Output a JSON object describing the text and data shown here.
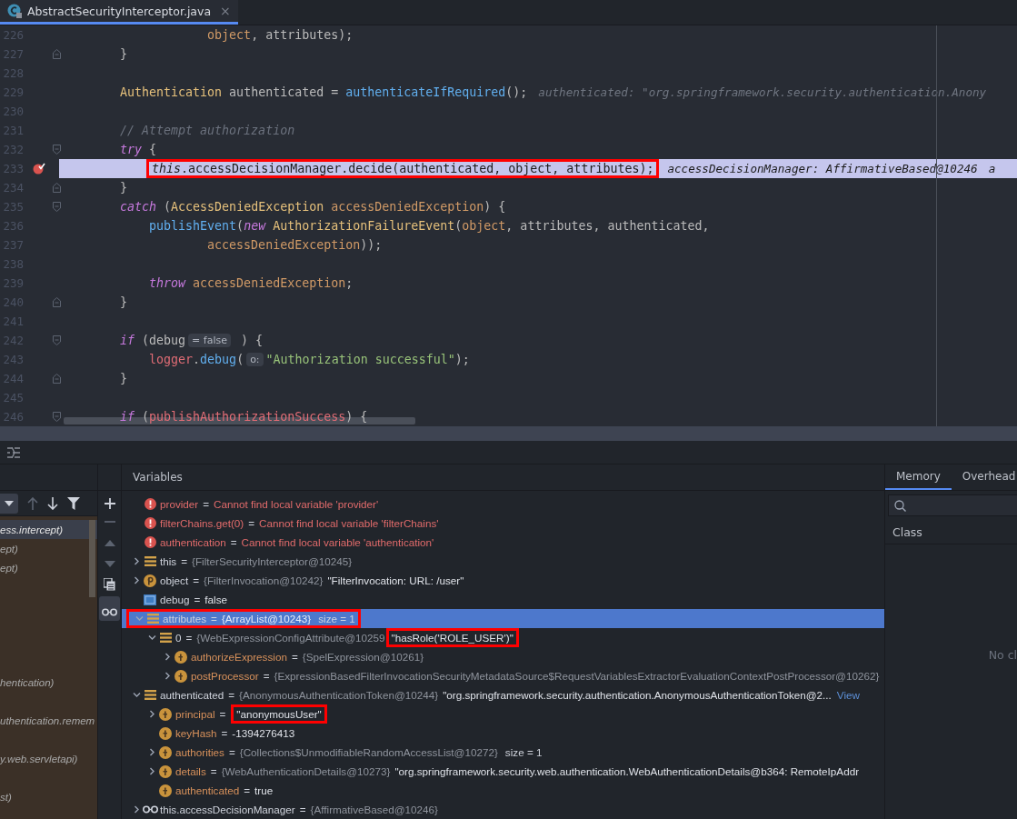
{
  "editor_tab": {
    "title": "AbstractSecurityInterceptor.java",
    "close": "×",
    "selected": true
  },
  "code_lines": [
    {
      "number": "226",
      "current": false,
      "breakpoint": false,
      "fold_start": false,
      "fold_end": false,
      "tokens": [
        {
          "kind": "local",
          "text": "                object"
        },
        {
          "kind": "plain",
          "text": ", attributes);"
        }
      ]
    },
    {
      "number": "227",
      "current": false,
      "breakpoint": false,
      "fold_start": false,
      "fold_end": true,
      "tokens": [
        {
          "kind": "plain",
          "text": "    }"
        }
      ]
    },
    {
      "number": "228",
      "current": false,
      "breakpoint": false,
      "fold_start": false,
      "fold_end": false
    },
    {
      "number": "229",
      "current": false,
      "breakpoint": false,
      "fold_start": false,
      "fold_end": false,
      "tokens": [
        {
          "kind": "type",
          "text": "    Authentication"
        },
        {
          "kind": "plain",
          "text": " authenticated = "
        },
        {
          "kind": "method",
          "text": "authenticateIfRequired"
        },
        {
          "kind": "plain",
          "text": "();"
        },
        {
          "kind": "hint",
          "text": "authenticated: \"org.springframework.security.authentication.Anony"
        }
      ]
    },
    {
      "number": "230",
      "current": false,
      "breakpoint": false,
      "fold_start": false,
      "fold_end": false
    },
    {
      "number": "231",
      "current": false,
      "breakpoint": false,
      "fold_start": false,
      "fold_end": false,
      "tokens": [
        {
          "kind": "comment",
          "text": "    // Attempt authorization"
        }
      ]
    },
    {
      "number": "232",
      "current": false,
      "breakpoint": false,
      "fold_start": true,
      "fold_end": false,
      "tokens": [
        {
          "kind": "keyword",
          "text": "    try"
        },
        {
          "kind": "plain",
          "text": " {"
        }
      ]
    },
    {
      "number": "233",
      "current": true,
      "breakpoint": true,
      "fold_start": false,
      "fold_end": false,
      "boxed": true,
      "tokens": [
        {
          "kind": "keyword",
          "text": "        this"
        },
        {
          "kind": "plain",
          "text": ".accessDecisionManager.decide(authenticated, object, attributes);"
        },
        {
          "kind": "hint",
          "text": "accessDecisionManager: AffirmativeBased@10246"
        },
        {
          "kind": "hint",
          "text": "a"
        }
      ]
    },
    {
      "number": "234",
      "current": false,
      "breakpoint": false,
      "fold_start": false,
      "fold_end": true,
      "tokens": [
        {
          "kind": "plain",
          "text": "    }"
        }
      ]
    },
    {
      "number": "235",
      "current": false,
      "breakpoint": false,
      "fold_start": true,
      "fold_end": false,
      "tokens": [
        {
          "kind": "keyword",
          "text": "    catch"
        },
        {
          "kind": "plain",
          "text": " ("
        },
        {
          "kind": "type",
          "text": "AccessDeniedException"
        },
        {
          "kind": "local",
          "text": " accessDeniedException"
        },
        {
          "kind": "plain",
          "text": ") {"
        }
      ]
    },
    {
      "number": "236",
      "current": false,
      "breakpoint": false,
      "fold_start": false,
      "fold_end": false,
      "tokens": [
        {
          "kind": "method",
          "text": "        publishEvent"
        },
        {
          "kind": "plain",
          "text": "("
        },
        {
          "kind": "keyword",
          "text": "new"
        },
        {
          "kind": "type",
          "text": " AuthorizationFailureEvent"
        },
        {
          "kind": "plain",
          "text": "("
        },
        {
          "kind": "local",
          "text": "object"
        },
        {
          "kind": "plain",
          "text": ", attributes, authenticated,"
        }
      ]
    },
    {
      "number": "237",
      "current": false,
      "breakpoint": false,
      "fold_start": false,
      "fold_end": false,
      "tokens": [
        {
          "kind": "local",
          "text": "                accessDeniedException"
        },
        {
          "kind": "plain",
          "text": "));"
        }
      ]
    },
    {
      "number": "238",
      "current": false,
      "breakpoint": false,
      "fold_start": false,
      "fold_end": false
    },
    {
      "number": "239",
      "current": false,
      "breakpoint": false,
      "fold_start": false,
      "fold_end": false,
      "tokens": [
        {
          "kind": "keyword",
          "text": "        throw"
        },
        {
          "kind": "local",
          "text": " accessDeniedException"
        },
        {
          "kind": "plain",
          "text": ";"
        }
      ]
    },
    {
      "number": "240",
      "current": false,
      "breakpoint": false,
      "fold_start": false,
      "fold_end": true,
      "tokens": [
        {
          "kind": "plain",
          "text": "    }"
        }
      ]
    },
    {
      "number": "241",
      "current": false,
      "breakpoint": false,
      "fold_start": false,
      "fold_end": false
    },
    {
      "number": "242",
      "current": false,
      "breakpoint": false,
      "fold_start": true,
      "fold_end": false,
      "tokens": [
        {
          "kind": "keyword",
          "text": "    if"
        },
        {
          "kind": "plain",
          "text": " (debug"
        },
        {
          "kind": "inlay",
          "text": "= false"
        },
        {
          "kind": "plain",
          "text": " ) {"
        }
      ]
    },
    {
      "number": "243",
      "current": false,
      "breakpoint": false,
      "fold_start": false,
      "fold_end": false,
      "tokens": [
        {
          "kind": "field",
          "text": "        logger"
        },
        {
          "kind": "plain",
          "text": "."
        },
        {
          "kind": "method",
          "text": "debug"
        },
        {
          "kind": "plain",
          "text": "("
        },
        {
          "kind": "inlay",
          "text": "o:"
        },
        {
          "kind": "string",
          "text": "\"Authorization successful\""
        },
        {
          "kind": "plain",
          "text": ");"
        }
      ]
    },
    {
      "number": "244",
      "current": false,
      "breakpoint": false,
      "fold_start": false,
      "fold_end": true,
      "tokens": [
        {
          "kind": "plain",
          "text": "    }"
        }
      ]
    },
    {
      "number": "245",
      "current": false,
      "breakpoint": false,
      "fold_start": false,
      "fold_end": false
    },
    {
      "number": "246",
      "current": false,
      "breakpoint": false,
      "fold_start": true,
      "fold_end": false,
      "tokens": [
        {
          "kind": "keyword",
          "text": "    if"
        },
        {
          "kind": "plain",
          "text": " ("
        },
        {
          "kind": "field",
          "text": "publishAuthorizationSuccess"
        },
        {
          "kind": "plain",
          "text": ") {"
        }
      ]
    }
  ],
  "frames": [
    {
      "kind": "frame",
      "label": "ess.intercept)",
      "selected": true
    },
    {
      "kind": "frame",
      "label": "ept)",
      "selected": false
    },
    {
      "kind": "frame",
      "label": "ept)",
      "selected": false
    },
    {
      "kind": "blank",
      "selected": false
    },
    {
      "kind": "blank",
      "selected": false
    },
    {
      "kind": "blank",
      "selected": false
    },
    {
      "kind": "blank",
      "selected": false
    },
    {
      "kind": "blank",
      "selected": false
    },
    {
      "kind": "frame",
      "label": "hentication)",
      "selected": false
    },
    {
      "kind": "blank",
      "selected": false
    },
    {
      "kind": "frame",
      "label": "uthentication.remem",
      "selected": false
    },
    {
      "kind": "blank",
      "selected": false
    },
    {
      "kind": "frame",
      "label": "y.web.servletapi)",
      "selected": false
    },
    {
      "kind": "blank",
      "selected": false
    },
    {
      "kind": "frame",
      "label": "st)",
      "selected": false
    }
  ],
  "variables": {
    "title": "Variables",
    "rows": [
      {
        "kind": "error",
        "name": "provider",
        "sign": "=",
        "value": "Cannot find local variable 'provider'",
        "selected": false
      },
      {
        "kind": "error",
        "name": "filterChains.get(0)",
        "sign": "=",
        "value": "Cannot find local variable 'filterChains'",
        "selected": false
      },
      {
        "kind": "error",
        "name": "authentication",
        "sign": "=",
        "value": "Cannot find local variable 'authentication'",
        "selected": false
      },
      {
        "kind": "object",
        "name": "this",
        "sign": "=",
        "type": "{FilterSecurityInterceptor@10245}",
        "expanded": false,
        "selected": false
      },
      {
        "kind": "parameter",
        "name": "object",
        "sign": "=",
        "type": "{FilterInvocation@10242}",
        "value": "\"FilterInvocation: URL: /user\"",
        "expanded": false,
        "selected": false
      },
      {
        "kind": "primitive",
        "name": "debug",
        "sign": "=",
        "value": "false",
        "selected": false
      },
      {
        "kind": "object",
        "name": "attributes",
        "sign": "=",
        "type": "{ArrayList@10243}",
        "extra": "size = 1",
        "expanded": true,
        "selected": true,
        "boxed": true,
        "children": [
          {
            "kind": "object",
            "name": "0",
            "sign": "=",
            "type": "{WebExpressionConfigAttribute@10259",
            "value": "\"hasRole('ROLE_USER')\"",
            "expanded": true,
            "selected": false,
            "value_boxed": true,
            "children": [
              {
                "kind": "field",
                "name": "authorizeExpression",
                "sign": "=",
                "type": "{SpelExpression@10261}",
                "expanded": false,
                "selected": false
              },
              {
                "kind": "field",
                "name": "postProcessor",
                "sign": "=",
                "type": "{ExpressionBasedFilterInvocationSecurityMetadataSource$RequestVariablesExtractorEvaluationContextPostProcessor@10262}",
                "expanded": false,
                "selected": false
              }
            ]
          }
        ]
      },
      {
        "kind": "object",
        "name": "authenticated",
        "sign": "=",
        "type": "{AnonymousAuthenticationToken@10244}",
        "value": "\"org.springframework.security.authentication.AnonymousAuthenticationToken@2...",
        "link": "View",
        "expanded": true,
        "selected": false,
        "children": [
          {
            "kind": "field",
            "name": "principal",
            "sign": "=",
            "value": "\"anonymousUser\"",
            "expanded": false,
            "selected": false,
            "value_boxed": true
          },
          {
            "kind": "field",
            "name": "keyHash",
            "sign": "=",
            "value": "-1394276413",
            "selected": false
          },
          {
            "kind": "field",
            "name": "authorities",
            "sign": "=",
            "type": "{Collections$UnmodifiableRandomAccessList@10272}",
            "extra": "size = 1",
            "expanded": false,
            "selected": false
          },
          {
            "kind": "field",
            "name": "details",
            "sign": "=",
            "type": "{WebAuthenticationDetails@10273}",
            "value": "\"org.springframework.security.web.authentication.WebAuthenticationDetails@b364: RemoteIpAddr",
            "expanded": false,
            "selected": false
          },
          {
            "kind": "field",
            "name": "authenticated",
            "sign": "=",
            "value": "true",
            "selected": false
          }
        ]
      },
      {
        "kind": "watch",
        "name": "this.accessDecisionManager",
        "sign": "=",
        "type": "{AffirmativeBased@10246}",
        "expanded": false,
        "selected": false
      }
    ]
  },
  "memory": {
    "tabs": [
      {
        "label": "Memory",
        "selected": true
      },
      {
        "label": "Overhead",
        "selected": false
      }
    ],
    "column": "Class",
    "empty_text": "No cl"
  }
}
